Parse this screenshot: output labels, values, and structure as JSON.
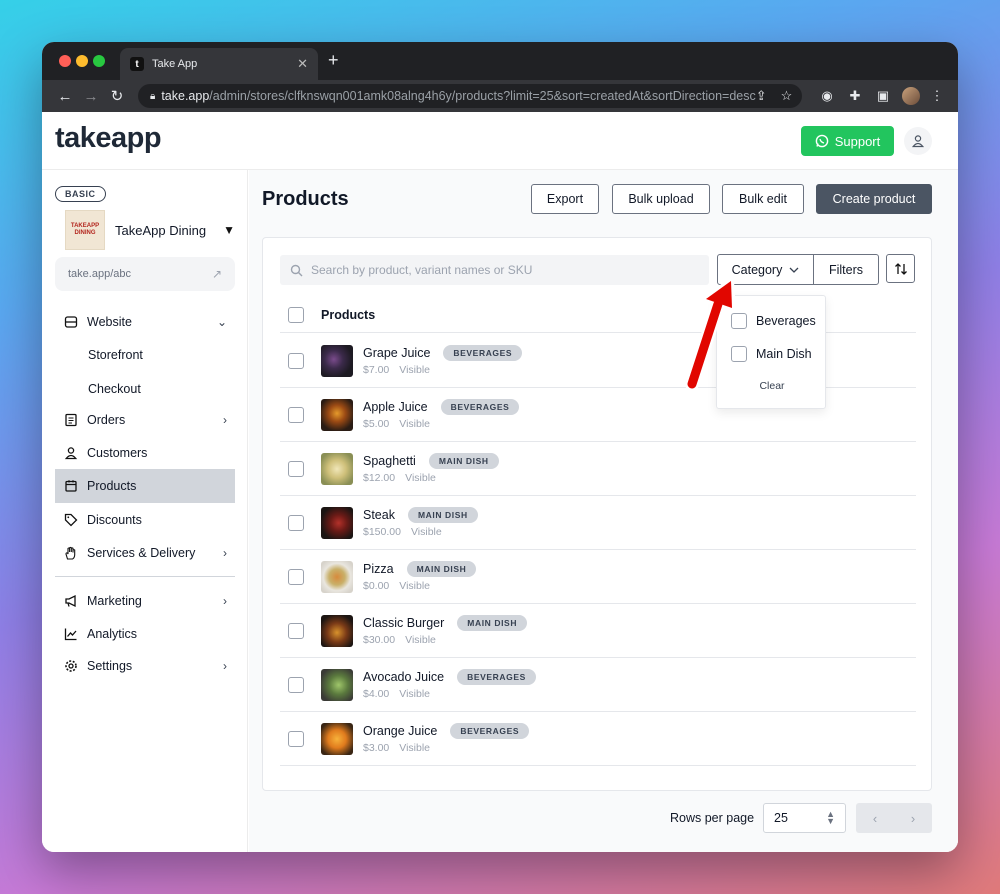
{
  "browser": {
    "tab_title": "Take App",
    "favicon_letter": "t",
    "url_host": "take.app",
    "url_path": "/admin/stores/clfknswqn001amk08alng4h6y/products?limit=25&sort=createdAt&sortDirection=desc"
  },
  "header": {
    "logo": "takeapp",
    "support_label": "Support"
  },
  "sidebar": {
    "plan_badge": "BASIC",
    "store_name": "TakeApp Dining",
    "store_logo_text": "TAKEAPP DINING",
    "store_link": "take.app/abc",
    "items": [
      {
        "label": "Website",
        "icon": "database-icon"
      },
      {
        "label": "Storefront"
      },
      {
        "label": "Checkout"
      },
      {
        "label": "Orders",
        "icon": "list-icon"
      },
      {
        "label": "Customers",
        "icon": "person-icon"
      },
      {
        "label": "Products",
        "icon": "calendar-icon"
      },
      {
        "label": "Discounts",
        "icon": "tag-icon"
      },
      {
        "label": "Services & Delivery",
        "icon": "hand-icon"
      },
      {
        "label": "Marketing",
        "icon": "megaphone-icon"
      },
      {
        "label": "Analytics",
        "icon": "chart-icon"
      },
      {
        "label": "Settings",
        "icon": "gear-icon"
      }
    ]
  },
  "main": {
    "title": "Products",
    "buttons": {
      "export": "Export",
      "bulk_upload": "Bulk upload",
      "bulk_edit": "Bulk edit",
      "create": "Create product"
    },
    "search_placeholder": "Search by product, variant names or SKU",
    "category_label": "Category",
    "filters_label": "Filters",
    "table_header": "Products",
    "products": [
      {
        "name": "Grape Juice",
        "category": "BEVERAGES",
        "price": "$7.00",
        "status": "Visible"
      },
      {
        "name": "Apple Juice",
        "category": "BEVERAGES",
        "price": "$5.00",
        "status": "Visible"
      },
      {
        "name": "Spaghetti",
        "category": "MAIN DISH",
        "price": "$12.00",
        "status": "Visible"
      },
      {
        "name": "Steak",
        "category": "MAIN DISH",
        "price": "$150.00",
        "status": "Visible"
      },
      {
        "name": "Pizza",
        "category": "MAIN DISH",
        "price": "$0.00",
        "status": "Visible"
      },
      {
        "name": "Classic Burger",
        "category": "MAIN DISH",
        "price": "$30.00",
        "status": "Visible"
      },
      {
        "name": "Avocado Juice",
        "category": "BEVERAGES",
        "price": "$4.00",
        "status": "Visible"
      },
      {
        "name": "Orange Juice",
        "category": "BEVERAGES",
        "price": "$3.00",
        "status": "Visible"
      }
    ],
    "category_dropdown": {
      "options": [
        "Beverages",
        "Main Dish"
      ],
      "clear": "Clear"
    },
    "pagination": {
      "rows_label": "Rows per page",
      "rows_value": "25"
    }
  },
  "colors": {
    "support_green": "#22c55e",
    "primary_button": "#4b5563",
    "active_nav": "#d1d5db",
    "annotation_arrow": "#e10600"
  }
}
